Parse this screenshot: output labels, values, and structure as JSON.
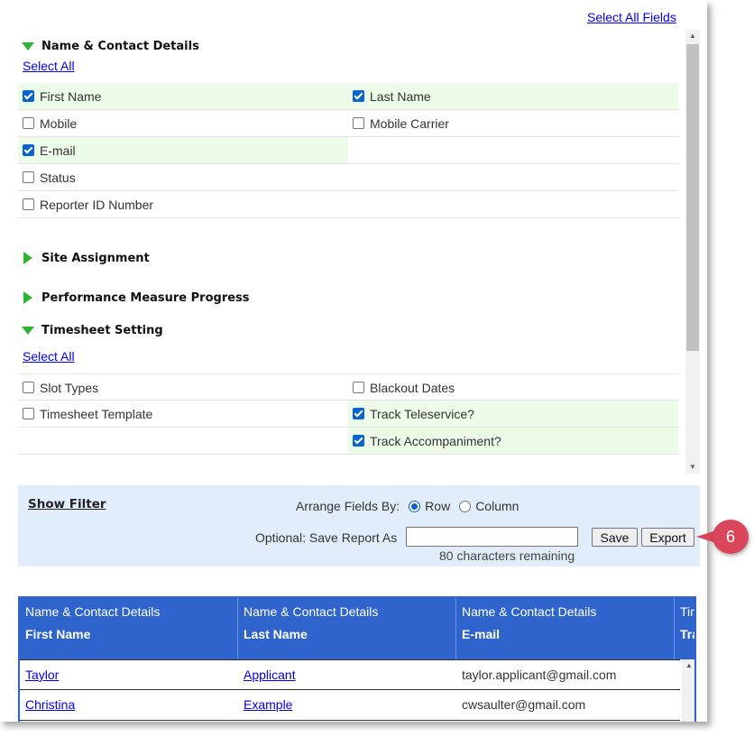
{
  "header": {
    "select_all_fields": "Select All Fields"
  },
  "sections": {
    "name_contact": {
      "title": "Name & Contact Details",
      "select_all": "Select All",
      "fields": [
        {
          "label": "First Name",
          "checked": true
        },
        {
          "label": "Last Name",
          "checked": true
        },
        {
          "label": "Mobile",
          "checked": false
        },
        {
          "label": "Mobile Carrier",
          "checked": false
        },
        {
          "label": "E-mail",
          "checked": true
        },
        {
          "label": "Status",
          "checked": false
        },
        {
          "label": "Reporter ID Number",
          "checked": false
        }
      ]
    },
    "site_assignment": {
      "title": "Site Assignment"
    },
    "performance": {
      "title": "Performance Measure Progress"
    },
    "timesheet": {
      "title": "Timesheet Setting",
      "select_all": "Select All",
      "fields": [
        {
          "label": "Slot Types",
          "checked": false
        },
        {
          "label": "Blackout Dates",
          "checked": false
        },
        {
          "label": "Timesheet Template",
          "checked": false
        },
        {
          "label": "Track Teleservice?",
          "checked": true
        },
        {
          "label": "Track Accompaniment?",
          "checked": true
        }
      ]
    }
  },
  "filter": {
    "show_filter": "Show Filter",
    "arrange_label": "Arrange Fields By:",
    "option_row": "Row",
    "option_column": "Column",
    "selected": "Row",
    "save_label": "Optional: Save Report As",
    "save_value": "",
    "remaining": "80 characters remaining",
    "save_button": "Save",
    "export_button": "Export"
  },
  "table": {
    "columns": [
      {
        "group": "Name & Contact Details",
        "field": "First Name"
      },
      {
        "group": "Name & Contact Details",
        "field": "Last Name"
      },
      {
        "group": "Name & Contact Details",
        "field": "E-mail"
      },
      {
        "group": "Tim",
        "field": "Tra"
      }
    ],
    "rows": [
      [
        "Taylor",
        "Applicant",
        "taylor.applicant@gmail.com"
      ],
      [
        "Christina",
        "Example",
        "cwsaulter@gmail.com"
      ]
    ]
  },
  "callout": {
    "number": "6"
  },
  "colors": {
    "accent_green": "#2cb534",
    "header_blue": "#2f64cc",
    "filter_bg": "#e1edfa",
    "callout_red": "#d9455a",
    "checked_bg": "#edfbe9"
  }
}
